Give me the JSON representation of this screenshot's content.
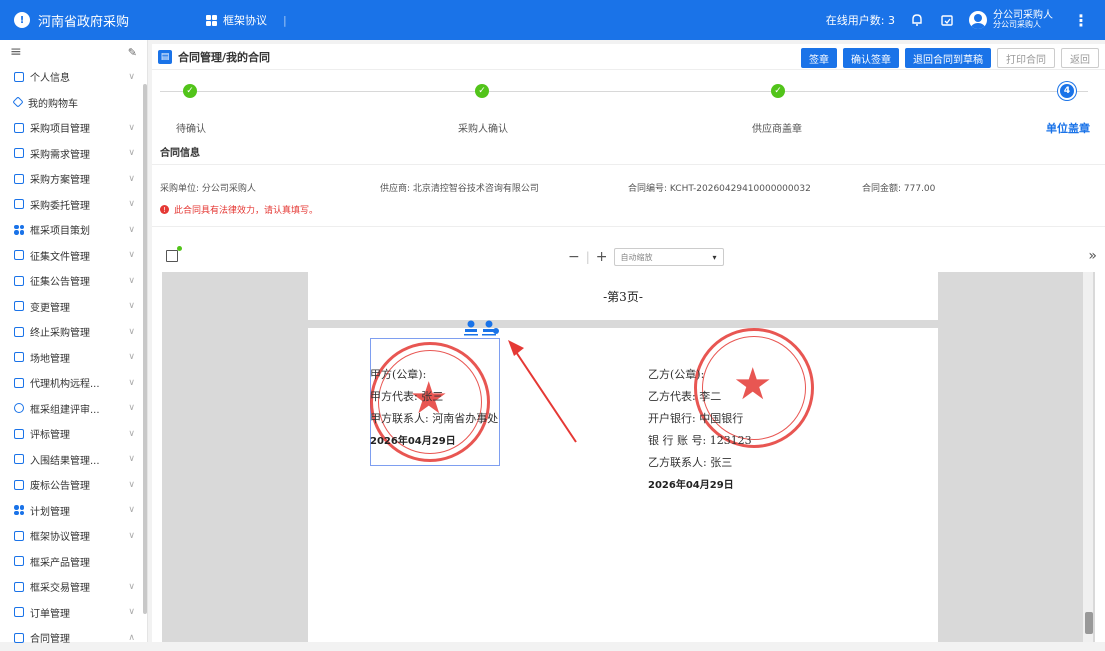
{
  "topbar": {
    "app_title": "河南省政府采购",
    "module_label": "框架协议",
    "separator": "|",
    "online_label": "在线用户数:",
    "online_count": "3",
    "user_name": "分公司采购人",
    "user_role": "分公司采购人"
  },
  "sidebar": {
    "items": [
      {
        "label": "个人信息"
      },
      {
        "label": "我的购物车"
      },
      {
        "label": "采购项目管理"
      },
      {
        "label": "采购需求管理"
      },
      {
        "label": "采购方案管理"
      },
      {
        "label": "采购委托管理"
      },
      {
        "label": "框采项目策划"
      },
      {
        "label": "征集文件管理"
      },
      {
        "label": "征集公告管理"
      },
      {
        "label": "变更管理"
      },
      {
        "label": "终止采购管理"
      },
      {
        "label": "场地管理"
      },
      {
        "label": "代理机构远程..."
      },
      {
        "label": "框采组建评审..."
      },
      {
        "label": "评标管理"
      },
      {
        "label": "入围结果管理..."
      },
      {
        "label": "废标公告管理"
      },
      {
        "label": "计划管理"
      },
      {
        "label": "框架协议管理"
      },
      {
        "label": "框采产品管理"
      },
      {
        "label": "框采交易管理"
      },
      {
        "label": "订单管理"
      },
      {
        "label": "合同管理"
      }
    ]
  },
  "main": {
    "title": "合同管理/我的合同",
    "buttons": {
      "sign": "签章",
      "confirm_sign": "确认签章",
      "return_draft": "退回合同到草稿",
      "print": "打印合同",
      "back": "返回"
    },
    "steps": [
      {
        "label": "待确认"
      },
      {
        "label": "采购人确认"
      },
      {
        "label": "供应商盖章"
      },
      {
        "label": "单位盖章",
        "number": "4"
      }
    ],
    "info_title": "合同信息",
    "info": {
      "buyer": "采购单位: 分公司采购人",
      "supplier": "供应商: 北京清控智谷技术咨询有限公司",
      "contract_no": "合同编号: KCHT-20260429410000000032",
      "amount": "合同金额: 777.00"
    },
    "warning": "此合同具有法律效力，请认真填写。"
  },
  "viewer": {
    "zoom_minus": "−",
    "zoom_plus": "+",
    "zoom_mode": "自动缩放",
    "expand": "»",
    "page_label": "-第3页-",
    "party_a": {
      "seal": "甲方(公章):",
      "rep": "甲方代表: 张三",
      "contact": "甲方联系人: 河南省办事处",
      "date": "2026年04月29日"
    },
    "party_b": {
      "seal": "乙方(公章):",
      "rep": "乙方代表: 李二",
      "bank": "开户银行: 中国银行",
      "account": "银 行 账 号: 123123",
      "contact": "乙方联系人: 张三",
      "date": "2026年04月29日"
    }
  },
  "colors": {
    "primary": "#1a73e8",
    "success": "#52c41a",
    "danger": "#e53935"
  }
}
